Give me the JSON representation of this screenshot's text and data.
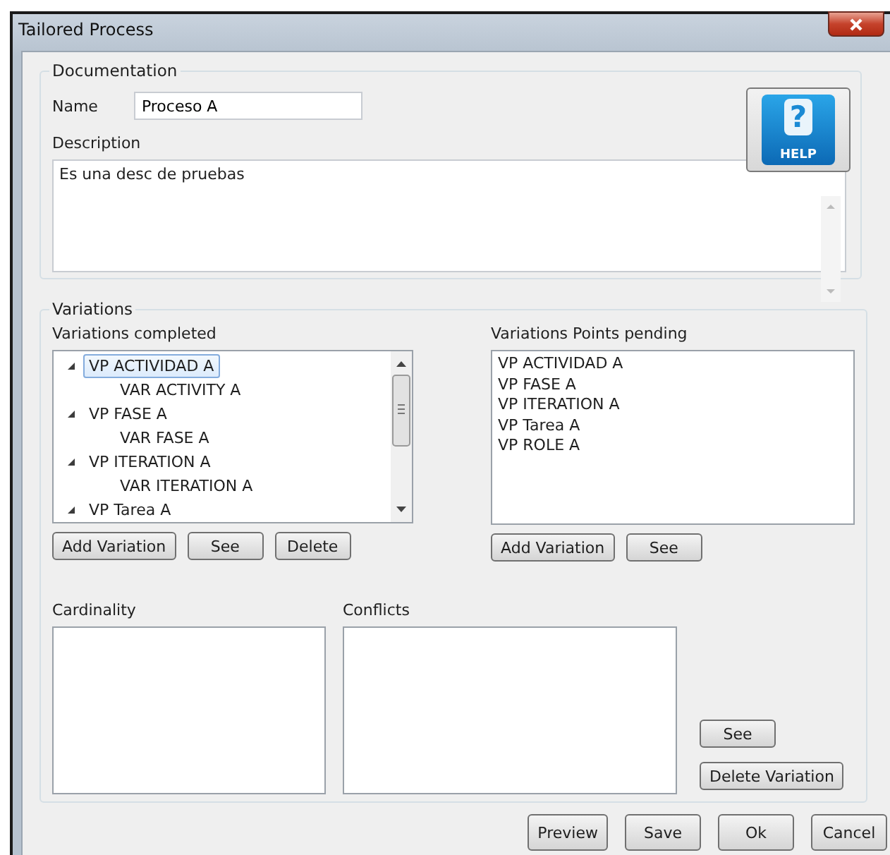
{
  "window": {
    "title": "Tailored Process"
  },
  "documentation": {
    "title": "Documentation",
    "name_label": "Name",
    "name_value": "Proceso A",
    "help_button": {
      "symbol": "?",
      "label": "HELP"
    },
    "description_label": "Description",
    "description_value": "Es una desc de pruebas"
  },
  "variations": {
    "title": "Variations",
    "completed": {
      "label": "Variations completed",
      "tree": [
        {
          "label": "VP ACTIVIDAD A",
          "expanded": true,
          "selected": true,
          "children": [
            {
              "label": "VAR ACTIVITY A",
              "selected": false
            }
          ]
        },
        {
          "label": "VP FASE A",
          "expanded": true,
          "selected": false,
          "children": [
            {
              "label": "VAR FASE A",
              "selected": false
            }
          ]
        },
        {
          "label": "VP ITERATION A",
          "expanded": true,
          "selected": false,
          "children": [
            {
              "label": "VAR ITERATION A",
              "selected": false
            }
          ]
        },
        {
          "label": "VP Tarea A",
          "expanded": true,
          "selected": false
        }
      ],
      "buttons": [
        "Add Variation",
        "See",
        "Delete"
      ]
    },
    "pending": {
      "label": "Variations Points pending",
      "items": [
        "VP ACTIVIDAD A",
        "VP FASE A",
        "VP ITERATION A",
        "VP Tarea A",
        "VP ROLE A"
      ],
      "buttons": [
        "Add Variation",
        "See"
      ]
    },
    "cardinality": {
      "label": "Cardinality"
    },
    "conflicts": {
      "label": "Conflicts"
    },
    "side_buttons": [
      "See",
      "Delete Variation"
    ]
  },
  "footer_buttons": [
    "Preview",
    "Save",
    "Ok",
    "Cancel"
  ]
}
